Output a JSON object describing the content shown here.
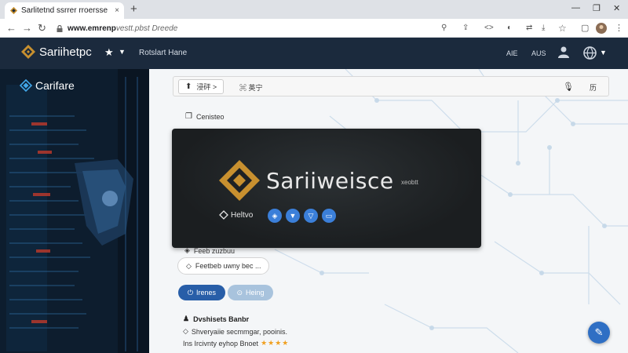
{
  "browser": {
    "tab_title": "Sarlitetnd ssrrer rroersse",
    "tab_close": "×",
    "new_tab": "+",
    "url_strong": "www.emrenp",
    "url_rest": "vestt.pbst Dreede",
    "min": "—",
    "max": "❐",
    "close": "✕"
  },
  "appbar": {
    "brand": "Sariihetpc",
    "app_name": "Rotslart Hane",
    "lang1": "AIE",
    "lang2": "AUS"
  },
  "sidebar": {
    "title": "Carifare"
  },
  "toolbar": {
    "group_label": "浸砰 >",
    "next_label": "⌘ 英宁",
    "extra_label": "历"
  },
  "section": {
    "label": "Cenisteo"
  },
  "hero": {
    "title": "Sariiweisce",
    "subtitle": "xeobtt",
    "tag": "Heltvo",
    "social": [
      "◈",
      "▼",
      "▽",
      "▭"
    ]
  },
  "details": {
    "label1": "Feeb zuzbuu",
    "chip_label": "Feetbeb uwny bec ...",
    "primary_btn": "Irenes",
    "secondary_btn": "Heing"
  },
  "description": {
    "heading": "Dvshisets Banbr",
    "line1": "Shveryaiie secmmgar, pooinis.",
    "line2": "Ins Ircivnty eyhop Bnoet",
    "stars": "★★★★"
  },
  "colors": {
    "appbar": "#1b2a3d",
    "accent": "#285ea8",
    "brand_gold": "#c8902f"
  }
}
